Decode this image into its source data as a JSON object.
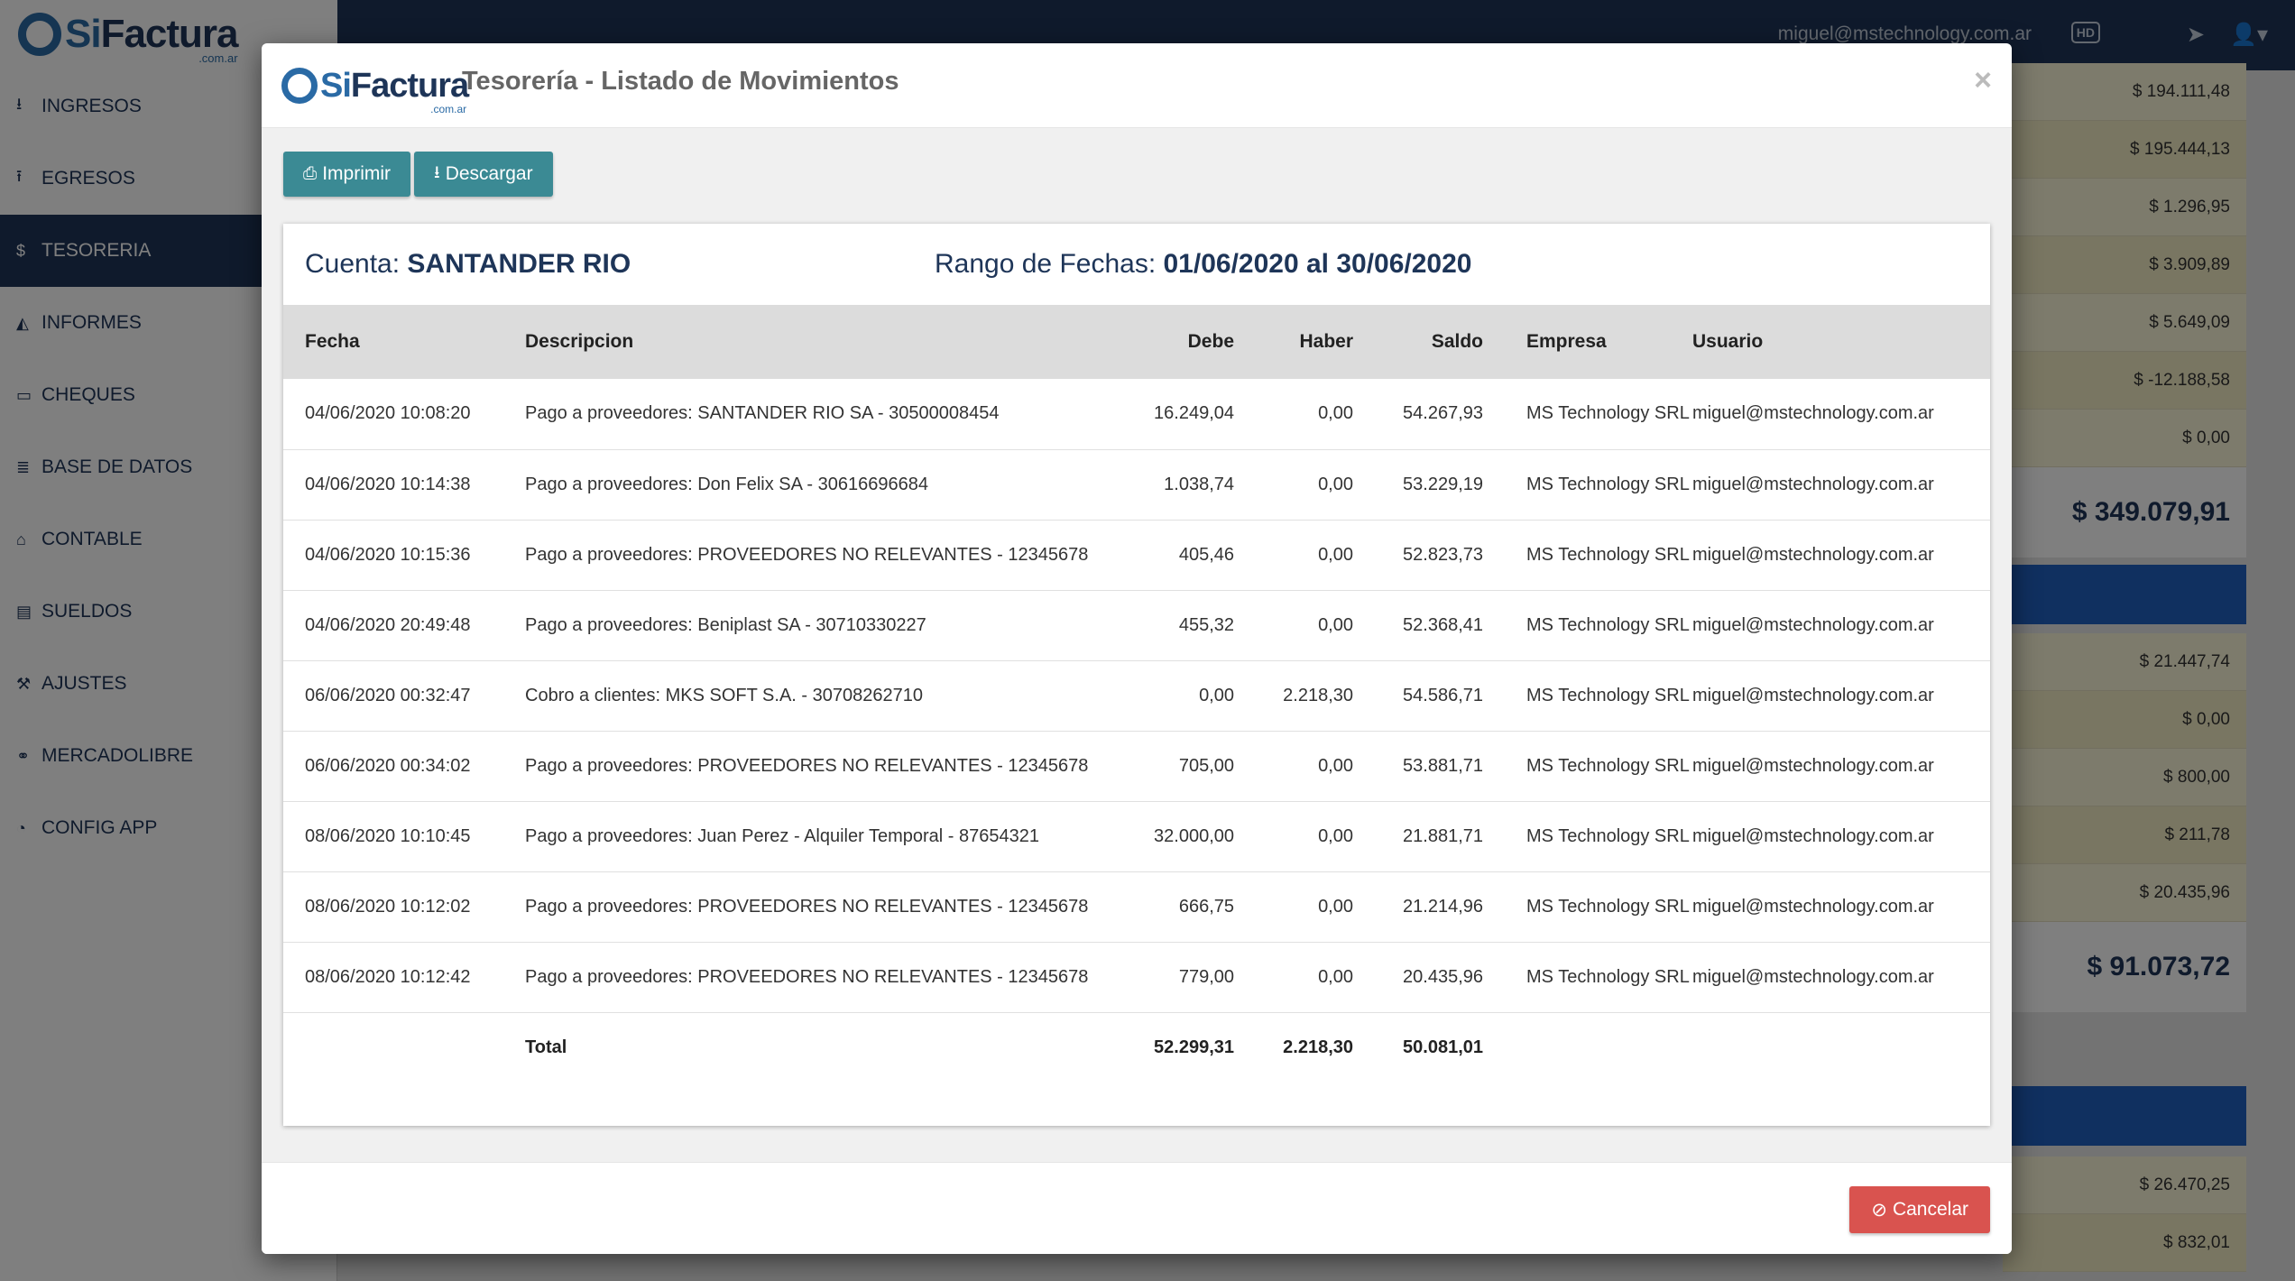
{
  "app": {
    "logo_si": "Si",
    "logo_factura": "Factura",
    "logo_tld": ".com.ar"
  },
  "topbar": {
    "user_email": "miguel@mstechnology.com.ar",
    "hd_label": "HD"
  },
  "sidebar": {
    "items": [
      {
        "label": "INGRESOS",
        "icon": "download-icon"
      },
      {
        "label": "EGRESOS",
        "icon": "upload-icon"
      },
      {
        "label": "TESORERIA",
        "icon": "dollar-icon",
        "active": true
      },
      {
        "label": "INFORMES",
        "icon": "area-chart-icon"
      },
      {
        "label": "CHEQUES",
        "icon": "credit-card-icon"
      },
      {
        "label": "BASE DE DATOS",
        "icon": "database-icon"
      },
      {
        "label": "CONTABLE",
        "icon": "bank-icon"
      },
      {
        "label": "SUELDOS",
        "icon": "book-icon"
      },
      {
        "label": "AJUSTES",
        "icon": "wrench-icon"
      },
      {
        "label": "MERCADOLIBRE",
        "icon": "handshake-icon"
      },
      {
        "label": "CONFIG APP",
        "icon": "tachometer-icon"
      }
    ]
  },
  "background_panel": {
    "group1": [
      "$ 194.111,48",
      "$ 195.444,13",
      "$ 1.296,95",
      "$ 3.909,89",
      "$ 5.649,09",
      "$ -12.188,58",
      "$ 0,00"
    ],
    "group1_total": "$ 349.079,91",
    "group2": [
      "$ 21.447,74",
      "$ 0,00",
      "$ 800,00",
      "$ 211,78",
      "$ 20.435,96"
    ],
    "group2_total": "$ 91.073,72",
    "group3": [
      "$ 26.470,25",
      "$ 832,01"
    ]
  },
  "modal": {
    "title": "Tesorería - Listado de Movimientos",
    "close_label": "×",
    "print_label": "Imprimir",
    "download_label": "Descargar",
    "cuenta_label": "Cuenta:",
    "cuenta_value": "SANTANDER RIO",
    "rango_label": "Rango de Fechas:",
    "rango_value": "01/06/2020 al 30/06/2020",
    "cancel_label": "Cancelar",
    "columns": [
      "Fecha",
      "Descripcion",
      "Debe",
      "Haber",
      "Saldo",
      "Empresa",
      "Usuario"
    ],
    "rows": [
      {
        "fecha": "04/06/2020 10:08:20",
        "descripcion": "Pago a proveedores: SANTANDER RIO SA - 30500008454",
        "debe": "16.249,04",
        "haber": "0,00",
        "saldo": "54.267,93",
        "empresa": "MS Technology SRL",
        "usuario": "miguel@mstechnology.com.ar"
      },
      {
        "fecha": "04/06/2020 10:14:38",
        "descripcion": "Pago a proveedores: Don Felix SA - 30616696684",
        "debe": "1.038,74",
        "haber": "0,00",
        "saldo": "53.229,19",
        "empresa": "MS Technology SRL",
        "usuario": "miguel@mstechnology.com.ar"
      },
      {
        "fecha": "04/06/2020 10:15:36",
        "descripcion": "Pago a proveedores: PROVEEDORES NO RELEVANTES - 12345678",
        "debe": "405,46",
        "haber": "0,00",
        "saldo": "52.823,73",
        "empresa": "MS Technology SRL",
        "usuario": "miguel@mstechnology.com.ar"
      },
      {
        "fecha": "04/06/2020 20:49:48",
        "descripcion": "Pago a proveedores: Beniplast SA - 30710330227",
        "debe": "455,32",
        "haber": "0,00",
        "saldo": "52.368,41",
        "empresa": "MS Technology SRL",
        "usuario": "miguel@mstechnology.com.ar"
      },
      {
        "fecha": "06/06/2020 00:32:47",
        "descripcion": "Cobro a clientes: MKS SOFT S.A. - 30708262710",
        "debe": "0,00",
        "haber": "2.218,30",
        "saldo": "54.586,71",
        "empresa": "MS Technology SRL",
        "usuario": "miguel@mstechnology.com.ar"
      },
      {
        "fecha": "06/06/2020 00:34:02",
        "descripcion": "Pago a proveedores: PROVEEDORES NO RELEVANTES - 12345678",
        "debe": "705,00",
        "haber": "0,00",
        "saldo": "53.881,71",
        "empresa": "MS Technology SRL",
        "usuario": "miguel@mstechnology.com.ar"
      },
      {
        "fecha": "08/06/2020 10:10:45",
        "descripcion": "Pago a proveedores: Juan Perez - Alquiler Temporal - 87654321",
        "debe": "32.000,00",
        "haber": "0,00",
        "saldo": "21.881,71",
        "empresa": "MS Technology SRL",
        "usuario": "miguel@mstechnology.com.ar"
      },
      {
        "fecha": "08/06/2020 10:12:02",
        "descripcion": "Pago a proveedores: PROVEEDORES NO RELEVANTES - 12345678",
        "debe": "666,75",
        "haber": "0,00",
        "saldo": "21.214,96",
        "empresa": "MS Technology SRL",
        "usuario": "miguel@mstechnology.com.ar"
      },
      {
        "fecha": "08/06/2020 10:12:42",
        "descripcion": "Pago a proveedores: PROVEEDORES NO RELEVANTES - 12345678",
        "debe": "779,00",
        "haber": "0,00",
        "saldo": "20.435,96",
        "empresa": "MS Technology SRL",
        "usuario": "miguel@mstechnology.com.ar"
      }
    ],
    "total": {
      "label": "Total",
      "debe": "52.299,31",
      "haber": "2.218,30",
      "saldo": "50.081,01"
    }
  },
  "colors": {
    "navy": "#1e3558",
    "brand_blue": "#2a6aa5",
    "teal_button": "#3b8a94",
    "danger": "#d9534f"
  }
}
